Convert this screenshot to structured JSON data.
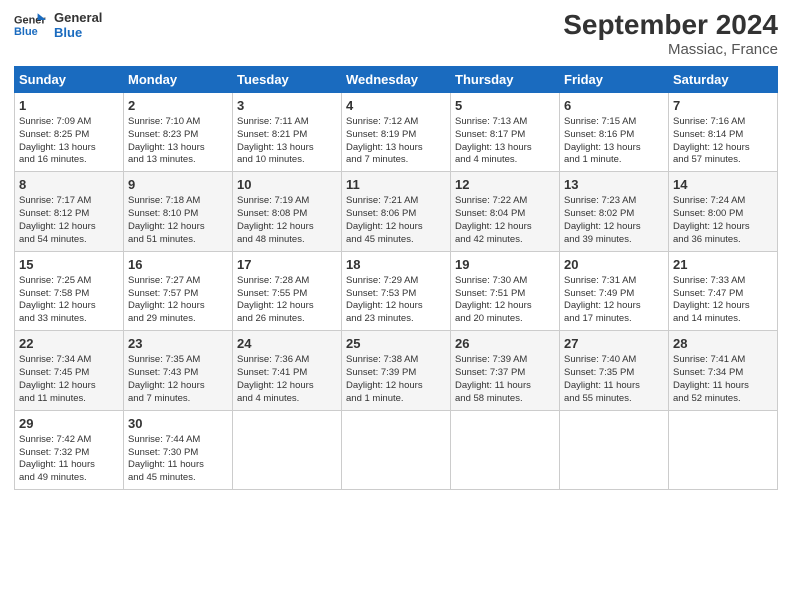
{
  "logo": {
    "line1": "General",
    "line2": "Blue"
  },
  "title": "September 2024",
  "subtitle": "Massiac, France",
  "header_days": [
    "Sunday",
    "Monday",
    "Tuesday",
    "Wednesday",
    "Thursday",
    "Friday",
    "Saturday"
  ],
  "weeks": [
    [
      {
        "day": "1",
        "lines": [
          "Sunrise: 7:09 AM",
          "Sunset: 8:25 PM",
          "Daylight: 13 hours",
          "and 16 minutes."
        ]
      },
      {
        "day": "2",
        "lines": [
          "Sunrise: 7:10 AM",
          "Sunset: 8:23 PM",
          "Daylight: 13 hours",
          "and 13 minutes."
        ]
      },
      {
        "day": "3",
        "lines": [
          "Sunrise: 7:11 AM",
          "Sunset: 8:21 PM",
          "Daylight: 13 hours",
          "and 10 minutes."
        ]
      },
      {
        "day": "4",
        "lines": [
          "Sunrise: 7:12 AM",
          "Sunset: 8:19 PM",
          "Daylight: 13 hours",
          "and 7 minutes."
        ]
      },
      {
        "day": "5",
        "lines": [
          "Sunrise: 7:13 AM",
          "Sunset: 8:17 PM",
          "Daylight: 13 hours",
          "and 4 minutes."
        ]
      },
      {
        "day": "6",
        "lines": [
          "Sunrise: 7:15 AM",
          "Sunset: 8:16 PM",
          "Daylight: 13 hours",
          "and 1 minute."
        ]
      },
      {
        "day": "7",
        "lines": [
          "Sunrise: 7:16 AM",
          "Sunset: 8:14 PM",
          "Daylight: 12 hours",
          "and 57 minutes."
        ]
      }
    ],
    [
      {
        "day": "8",
        "lines": [
          "Sunrise: 7:17 AM",
          "Sunset: 8:12 PM",
          "Daylight: 12 hours",
          "and 54 minutes."
        ]
      },
      {
        "day": "9",
        "lines": [
          "Sunrise: 7:18 AM",
          "Sunset: 8:10 PM",
          "Daylight: 12 hours",
          "and 51 minutes."
        ]
      },
      {
        "day": "10",
        "lines": [
          "Sunrise: 7:19 AM",
          "Sunset: 8:08 PM",
          "Daylight: 12 hours",
          "and 48 minutes."
        ]
      },
      {
        "day": "11",
        "lines": [
          "Sunrise: 7:21 AM",
          "Sunset: 8:06 PM",
          "Daylight: 12 hours",
          "and 45 minutes."
        ]
      },
      {
        "day": "12",
        "lines": [
          "Sunrise: 7:22 AM",
          "Sunset: 8:04 PM",
          "Daylight: 12 hours",
          "and 42 minutes."
        ]
      },
      {
        "day": "13",
        "lines": [
          "Sunrise: 7:23 AM",
          "Sunset: 8:02 PM",
          "Daylight: 12 hours",
          "and 39 minutes."
        ]
      },
      {
        "day": "14",
        "lines": [
          "Sunrise: 7:24 AM",
          "Sunset: 8:00 PM",
          "Daylight: 12 hours",
          "and 36 minutes."
        ]
      }
    ],
    [
      {
        "day": "15",
        "lines": [
          "Sunrise: 7:25 AM",
          "Sunset: 7:58 PM",
          "Daylight: 12 hours",
          "and 33 minutes."
        ]
      },
      {
        "day": "16",
        "lines": [
          "Sunrise: 7:27 AM",
          "Sunset: 7:57 PM",
          "Daylight: 12 hours",
          "and 29 minutes."
        ]
      },
      {
        "day": "17",
        "lines": [
          "Sunrise: 7:28 AM",
          "Sunset: 7:55 PM",
          "Daylight: 12 hours",
          "and 26 minutes."
        ]
      },
      {
        "day": "18",
        "lines": [
          "Sunrise: 7:29 AM",
          "Sunset: 7:53 PM",
          "Daylight: 12 hours",
          "and 23 minutes."
        ]
      },
      {
        "day": "19",
        "lines": [
          "Sunrise: 7:30 AM",
          "Sunset: 7:51 PM",
          "Daylight: 12 hours",
          "and 20 minutes."
        ]
      },
      {
        "day": "20",
        "lines": [
          "Sunrise: 7:31 AM",
          "Sunset: 7:49 PM",
          "Daylight: 12 hours",
          "and 17 minutes."
        ]
      },
      {
        "day": "21",
        "lines": [
          "Sunrise: 7:33 AM",
          "Sunset: 7:47 PM",
          "Daylight: 12 hours",
          "and 14 minutes."
        ]
      }
    ],
    [
      {
        "day": "22",
        "lines": [
          "Sunrise: 7:34 AM",
          "Sunset: 7:45 PM",
          "Daylight: 12 hours",
          "and 11 minutes."
        ]
      },
      {
        "day": "23",
        "lines": [
          "Sunrise: 7:35 AM",
          "Sunset: 7:43 PM",
          "Daylight: 12 hours",
          "and 7 minutes."
        ]
      },
      {
        "day": "24",
        "lines": [
          "Sunrise: 7:36 AM",
          "Sunset: 7:41 PM",
          "Daylight: 12 hours",
          "and 4 minutes."
        ]
      },
      {
        "day": "25",
        "lines": [
          "Sunrise: 7:38 AM",
          "Sunset: 7:39 PM",
          "Daylight: 12 hours",
          "and 1 minute."
        ]
      },
      {
        "day": "26",
        "lines": [
          "Sunrise: 7:39 AM",
          "Sunset: 7:37 PM",
          "Daylight: 11 hours",
          "and 58 minutes."
        ]
      },
      {
        "day": "27",
        "lines": [
          "Sunrise: 7:40 AM",
          "Sunset: 7:35 PM",
          "Daylight: 11 hours",
          "and 55 minutes."
        ]
      },
      {
        "day": "28",
        "lines": [
          "Sunrise: 7:41 AM",
          "Sunset: 7:34 PM",
          "Daylight: 11 hours",
          "and 52 minutes."
        ]
      }
    ],
    [
      {
        "day": "29",
        "lines": [
          "Sunrise: 7:42 AM",
          "Sunset: 7:32 PM",
          "Daylight: 11 hours",
          "and 49 minutes."
        ]
      },
      {
        "day": "30",
        "lines": [
          "Sunrise: 7:44 AM",
          "Sunset: 7:30 PM",
          "Daylight: 11 hours",
          "and 45 minutes."
        ]
      },
      null,
      null,
      null,
      null,
      null
    ]
  ]
}
